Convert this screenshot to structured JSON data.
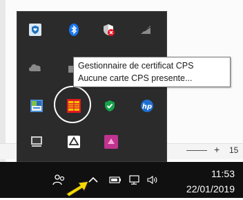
{
  "tooltip": {
    "title": "Gestionnaire de certificat CPS",
    "status": "Aucune carte CPS presente..."
  },
  "ruler": {
    "plus": "+",
    "number": "15"
  },
  "tray": {
    "icons": [
      {
        "name": "shield-heart-icon"
      },
      {
        "name": "bluetooth-icon"
      },
      {
        "name": "shield-x-icon"
      },
      {
        "name": "wifi-icon"
      },
      {
        "name": "cloud-icon"
      },
      {
        "name": "hidden-icon"
      },
      {
        "name": "app-icon"
      },
      {
        "name": "cps-card-icon"
      },
      {
        "name": "security-check-icon"
      },
      {
        "name": "hp-icon"
      },
      {
        "name": "monitor-icon"
      },
      {
        "name": "drive-icon"
      },
      {
        "name": "pink-app-icon"
      }
    ]
  },
  "clock": {
    "time": "11:53",
    "date": "22/01/2019"
  },
  "colors": {
    "accent": "#e11b22",
    "callout": "#f5d800",
    "taskbar": "#101010"
  }
}
